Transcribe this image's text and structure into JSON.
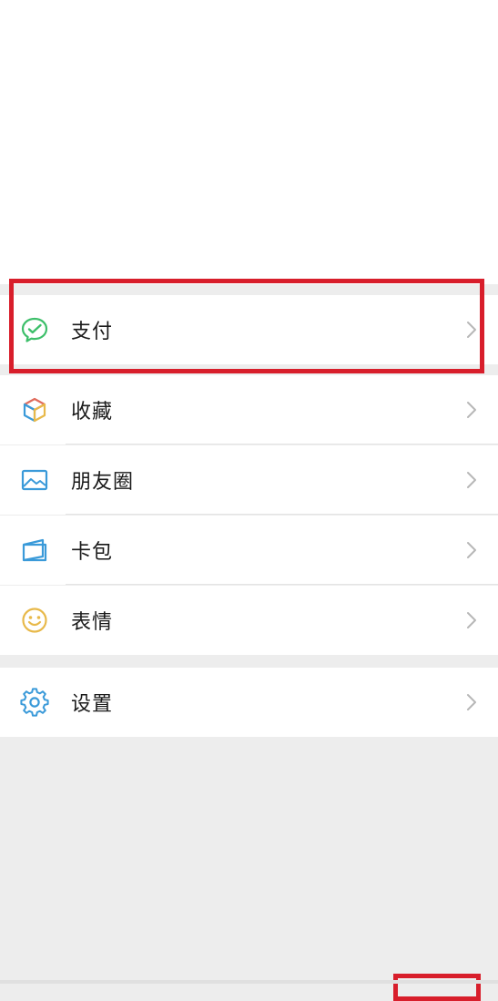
{
  "menu": {
    "items": [
      {
        "label": "支付",
        "icon": "wechat-pay-icon"
      },
      {
        "label": "收藏",
        "icon": "favorites-cube-icon"
      },
      {
        "label": "朋友圈",
        "icon": "moments-photo-icon"
      },
      {
        "label": "卡包",
        "icon": "card-wallet-icon"
      },
      {
        "label": "表情",
        "icon": "sticker-smiley-icon"
      },
      {
        "label": "设置",
        "icon": "settings-gear-icon"
      }
    ]
  },
  "colors": {
    "highlight": "#d81e2b",
    "pay_green": "#3dbf6a",
    "card_blue": "#3a9ad9",
    "sticker_yellow": "#e8b94a",
    "background": "#ededed"
  }
}
